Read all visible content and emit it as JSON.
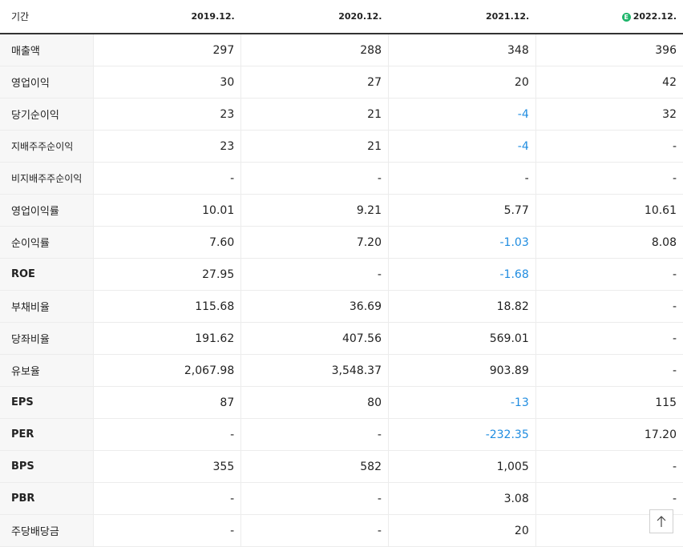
{
  "header": {
    "label": "기간",
    "periods": [
      "2019.12.",
      "2020.12.",
      "2021.12.",
      "2022.12."
    ],
    "estimate_badge": "E"
  },
  "rows": [
    {
      "label": "매출액",
      "values": [
        "297",
        "288",
        "348",
        "396"
      ]
    },
    {
      "label": "영업이익",
      "values": [
        "30",
        "27",
        "20",
        "42"
      ]
    },
    {
      "label": "당기순이익",
      "values": [
        "23",
        "21",
        "-4",
        "32"
      ]
    },
    {
      "label": "지배주주순이익",
      "values": [
        "23",
        "21",
        "-4",
        "-"
      ]
    },
    {
      "label": "비지배주주순이익",
      "values": [
        "-",
        "-",
        "-",
        "-"
      ]
    },
    {
      "label": "영업이익률",
      "values": [
        "10.01",
        "9.21",
        "5.77",
        "10.61"
      ]
    },
    {
      "label": "순이익률",
      "values": [
        "7.60",
        "7.20",
        "-1.03",
        "8.08"
      ]
    },
    {
      "label": "ROE",
      "values": [
        "27.95",
        "-",
        "-1.68",
        "-"
      ]
    },
    {
      "label": "부채비율",
      "values": [
        "115.68",
        "36.69",
        "18.82",
        "-"
      ]
    },
    {
      "label": "당좌비율",
      "values": [
        "191.62",
        "407.56",
        "569.01",
        "-"
      ]
    },
    {
      "label": "유보율",
      "values": [
        "2,067.98",
        "3,548.37",
        "903.89",
        "-"
      ]
    },
    {
      "label": "EPS",
      "values": [
        "87",
        "80",
        "-13",
        "115"
      ]
    },
    {
      "label": "PER",
      "values": [
        "-",
        "-",
        "-232.35",
        "17.20"
      ]
    },
    {
      "label": "BPS",
      "values": [
        "355",
        "582",
        "1,005",
        "-"
      ]
    },
    {
      "label": "PBR",
      "values": [
        "-",
        "-",
        "3.08",
        "-"
      ]
    },
    {
      "label": "주당배당금",
      "values": [
        "-",
        "-",
        "20",
        ""
      ]
    }
  ],
  "colors": {
    "negative": "#1f8ce0",
    "estimate_badge": "#1fb56b"
  },
  "scroll_top_icon": "arrow-up-icon"
}
